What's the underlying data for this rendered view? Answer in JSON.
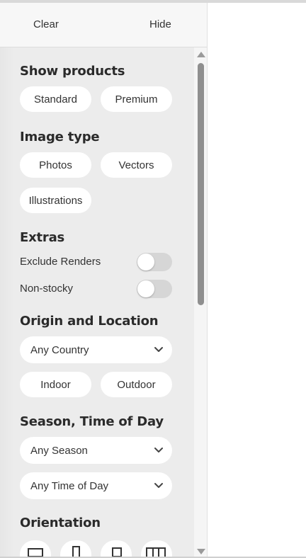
{
  "header": {
    "clear_label": "Clear",
    "hide_label": "Hide"
  },
  "show_products": {
    "heading": "Show products",
    "options": [
      "Standard",
      "Premium"
    ]
  },
  "image_type": {
    "heading": "Image type",
    "options": [
      "Photos",
      "Vectors",
      "Illustrations"
    ]
  },
  "extras": {
    "heading": "Extras",
    "toggles": [
      {
        "label": "Exclude Renders",
        "on": false
      },
      {
        "label": "Non-stocky",
        "on": false
      }
    ]
  },
  "origin": {
    "heading": "Origin and Location",
    "country_select": "Any Country",
    "options": [
      "Indoor",
      "Outdoor"
    ]
  },
  "season": {
    "heading": "Season, Time of Day",
    "season_select": "Any Season",
    "time_select": "Any Time of Day"
  },
  "orientation": {
    "heading": "Orientation",
    "icons": [
      "landscape-icon",
      "portrait-icon",
      "square-icon",
      "panoramic-icon"
    ]
  },
  "colors": {
    "panel_bg": "#ececec",
    "pill_bg": "#ffffff",
    "toggle_off": "#d6d6d6",
    "scroll_thumb": "#8f8f8f"
  }
}
